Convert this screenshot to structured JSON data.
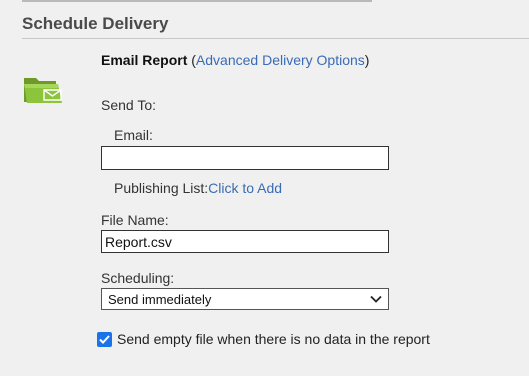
{
  "section": {
    "title": "Schedule Delivery"
  },
  "email_report": {
    "title": "Email Report",
    "open_paren": " (",
    "advanced_link": "Advanced Delivery Options",
    "close_paren": ")"
  },
  "send_to": {
    "label": "Send To:",
    "email_label": "Email:",
    "email_value": "",
    "publishing_list_label": "Publishing List:",
    "publishing_list_link": "Click to Add"
  },
  "file_name": {
    "label": "File Name:",
    "value": "Report.csv"
  },
  "scheduling": {
    "label": "Scheduling:",
    "selected": "Send immediately"
  },
  "send_empty": {
    "label": "Send empty file when there is no data in the report",
    "checked": true
  },
  "icons": {
    "folder": "email-folder-icon",
    "dropdown": "chevron-down-icon",
    "check": "checkmark-icon"
  },
  "colors": {
    "link": "#3a6bb5",
    "checkbox": "#1a73e8",
    "folder": "#8cc43c"
  }
}
